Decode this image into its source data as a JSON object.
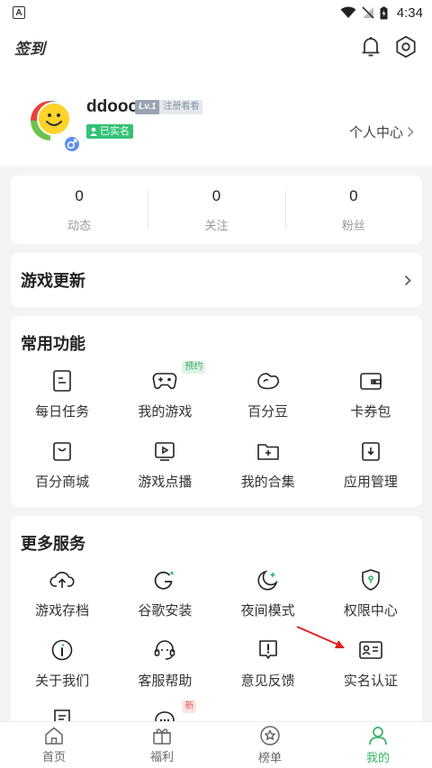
{
  "status_bar": {
    "time": "4:34"
  },
  "header": {
    "signin_label": "签到"
  },
  "profile": {
    "username": "ddooo",
    "level": "Lv.1",
    "level_note": "注册看看",
    "verified_label": "已实名",
    "personal_center_label": "个人中心"
  },
  "stats": [
    {
      "value": "0",
      "label": "动态"
    },
    {
      "value": "0",
      "label": "关注"
    },
    {
      "value": "0",
      "label": "粉丝"
    }
  ],
  "game_update": {
    "title": "游戏更新"
  },
  "common": {
    "title": "常用功能",
    "items": [
      {
        "label": "每日任务",
        "icon": "daily-task-icon"
      },
      {
        "label": "我的游戏",
        "icon": "gamepad-icon",
        "tag": "预约"
      },
      {
        "label": "百分豆",
        "icon": "bean-icon"
      },
      {
        "label": "卡券包",
        "icon": "wallet-icon"
      },
      {
        "label": "百分商城",
        "icon": "shop-bag-icon"
      },
      {
        "label": "游戏点播",
        "icon": "video-play-icon"
      },
      {
        "label": "我的合集",
        "icon": "folder-plus-icon"
      },
      {
        "label": "应用管理",
        "icon": "download-icon"
      }
    ]
  },
  "more": {
    "title": "更多服务",
    "items": [
      {
        "label": "游戏存档",
        "icon": "cloud-upload-icon"
      },
      {
        "label": "谷歌安装",
        "icon": "google-icon"
      },
      {
        "label": "夜间模式",
        "icon": "moon-icon"
      },
      {
        "label": "权限中心",
        "icon": "shield-icon"
      },
      {
        "label": "关于我们",
        "icon": "info-icon"
      },
      {
        "label": "客服帮助",
        "icon": "headset-icon"
      },
      {
        "label": "意见反馈",
        "icon": "feedback-icon"
      },
      {
        "label": "实名认证",
        "icon": "id-card-icon"
      },
      {
        "label": "",
        "icon": "document-icon"
      },
      {
        "label": "",
        "icon": "chat-icon",
        "tag": "新"
      }
    ]
  },
  "bottom_nav": [
    {
      "label": "首页",
      "icon": "home-icon"
    },
    {
      "label": "福利",
      "icon": "gift-icon"
    },
    {
      "label": "榜单",
      "icon": "star-badge-icon"
    },
    {
      "label": "我的",
      "icon": "user-icon",
      "active": true
    }
  ],
  "colors": {
    "accent": "#35b46a",
    "annotation_arrow": "#e02020"
  }
}
